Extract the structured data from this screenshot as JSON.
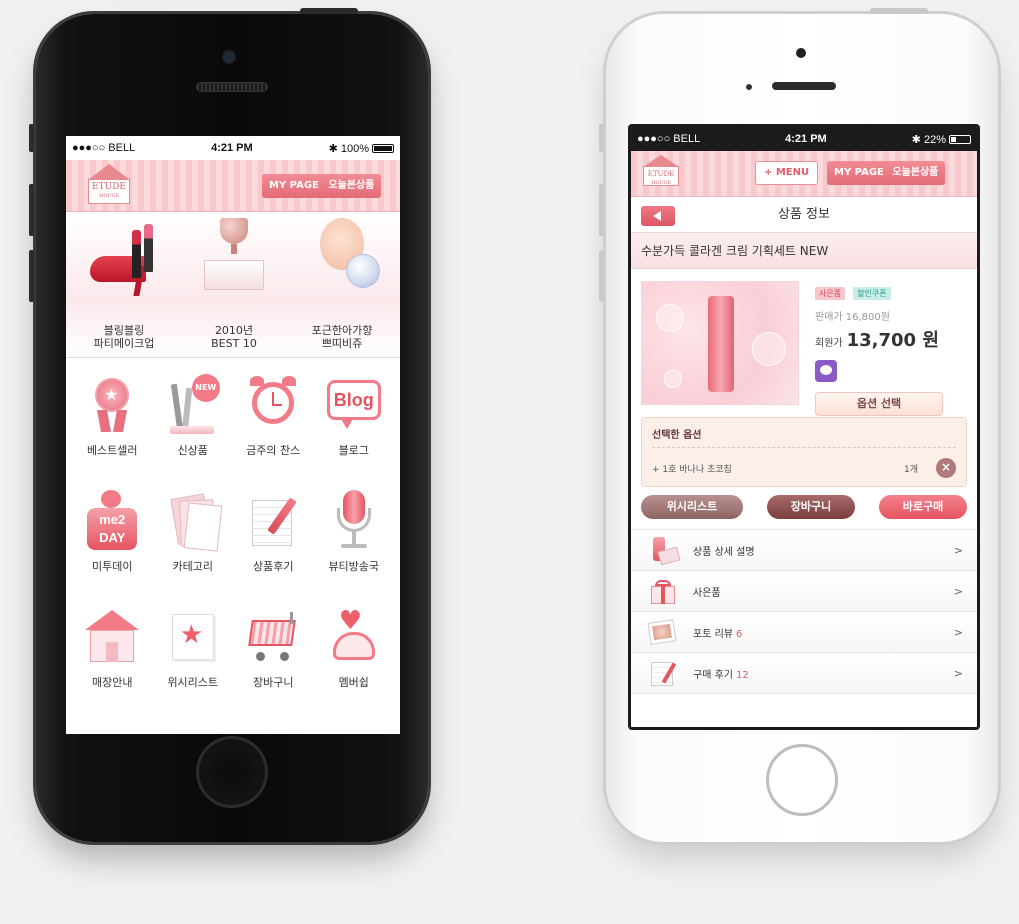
{
  "left_phone": {
    "status": {
      "carrier": "●●●○○ BELL",
      "time": "4:21 PM",
      "battery": "100%"
    },
    "header": {
      "logo": "ETUDE",
      "logo_sub": "HOUSE",
      "mypage": "MY PAGE",
      "today": "오늘본상품"
    },
    "banner": [
      {
        "line1": "블링블링",
        "line2": "파티메이크업"
      },
      {
        "line1": "2010년",
        "line2": "BEST 10"
      },
      {
        "line1": "포근한아가향",
        "line2": "쁘띠비쥬"
      }
    ],
    "grid": [
      {
        "label": "베스트셀러",
        "icon": "medal-icon"
      },
      {
        "label": "신상품",
        "icon": "new-product-icon"
      },
      {
        "label": "금주의 찬스",
        "icon": "alarm-clock-icon"
      },
      {
        "label": "블로그",
        "icon": "blog-icon"
      },
      {
        "label": "미투데이",
        "icon": "me2day-icon"
      },
      {
        "label": "카테고리",
        "icon": "category-icon"
      },
      {
        "label": "상품후기",
        "icon": "review-icon"
      },
      {
        "label": "뷰티방송국",
        "icon": "microphone-icon"
      },
      {
        "label": "매장안내",
        "icon": "store-icon"
      },
      {
        "label": "위시리스트",
        "icon": "wishlist-icon"
      },
      {
        "label": "장바구니",
        "icon": "cart-icon"
      },
      {
        "label": "멤버쉽",
        "icon": "membership-icon"
      }
    ],
    "blog_text": "Blog",
    "me2day_text": "me2 DAY",
    "new_badge": "NEW"
  },
  "right_phone": {
    "status": {
      "carrier": "●●●○○ BELL",
      "time": "4:21 PM",
      "battery": "22%"
    },
    "header": {
      "logo": "ETUDE",
      "logo_sub": "HOUSE",
      "menu": "+ MENU",
      "mypage": "MY PAGE",
      "today": "오늘본상품"
    },
    "title": "상품 정보",
    "product_name": "수분가득 콜라겐 크림 기획세트 NEW",
    "tags": [
      "사은품",
      "할인쿠폰"
    ],
    "original_price": "판매가 16,800원",
    "member_label": "회원가",
    "member_price": "13,700 원",
    "option_button": "옵션 선택",
    "selected_title": "선택한 옵션",
    "selected_item": "+ 1호 바나나 초코칩",
    "selected_qty": "1개",
    "actions": {
      "wishlist": "위시리스트",
      "cart": "장바구니",
      "buy": "바로구매"
    },
    "menu": [
      {
        "label": "상품 상세 설명",
        "count": ""
      },
      {
        "label": "사은품",
        "count": ""
      },
      {
        "label": "포토 리뷰",
        "count": "6"
      },
      {
        "label": "구매 후기",
        "count": "12"
      }
    ]
  },
  "colors": {
    "accent": "#e36b76",
    "stripe_light": "#fbdadd",
    "stripe_dark": "#f7c9cd"
  }
}
